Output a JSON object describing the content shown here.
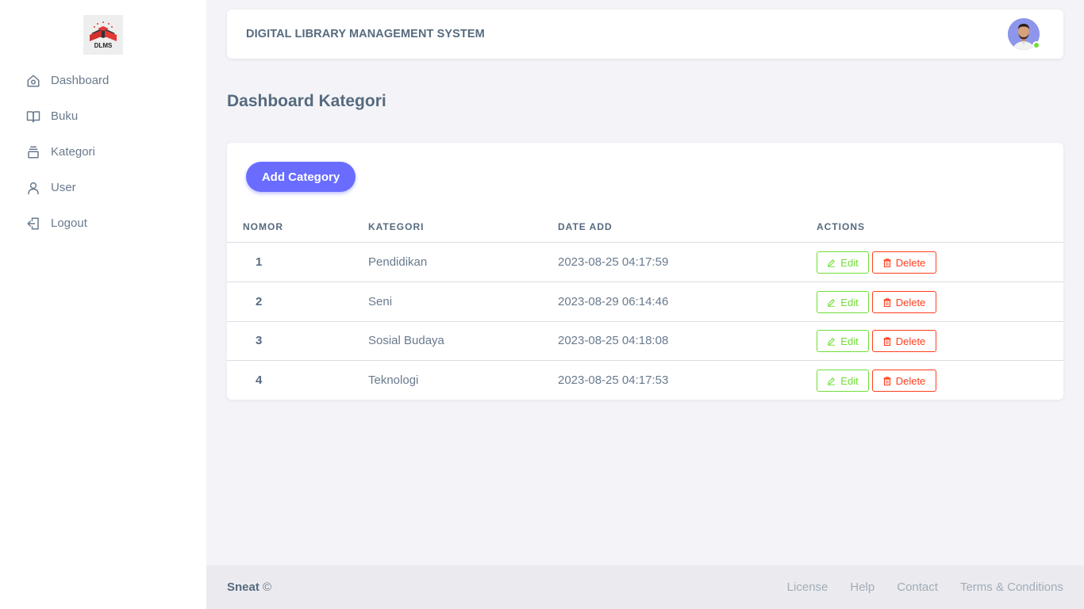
{
  "brand": {
    "logo_text": "DLMS"
  },
  "sidebar": {
    "items": [
      {
        "label": "Dashboard",
        "icon": "home-icon"
      },
      {
        "label": "Buku",
        "icon": "book-icon"
      },
      {
        "label": "Kategori",
        "icon": "collection-icon"
      },
      {
        "label": "User",
        "icon": "user-icon"
      },
      {
        "label": "Logout",
        "icon": "logout-icon"
      }
    ]
  },
  "navbar": {
    "title": "DIGITAL LIBRARY MANAGEMENT SYSTEM",
    "avatar": "user-avatar",
    "status_color": "#71dd37"
  },
  "page": {
    "title": "Dashboard Kategori"
  },
  "card": {
    "add_button": "Add Category",
    "table": {
      "headers": [
        "NOMOR",
        "KATEGORI",
        "DATE ADD",
        "ACTIONS"
      ],
      "rows": [
        {
          "no": "1",
          "kategori": "Pendidikan",
          "date": "2023-08-25 04:17:59"
        },
        {
          "no": "2",
          "kategori": "Seni",
          "date": "2023-08-29 06:14:46"
        },
        {
          "no": "3",
          "kategori": "Sosial Budaya",
          "date": "2023-08-25 04:18:08"
        },
        {
          "no": "4",
          "kategori": "Teknologi",
          "date": "2023-08-25 04:17:53"
        }
      ],
      "edit_label": "Edit",
      "delete_label": "Delete"
    }
  },
  "footer": {
    "brand": "Sneat",
    "copyright": "©",
    "links": [
      "License",
      "Help",
      "Contact",
      "Terms & Conditions"
    ]
  },
  "colors": {
    "primary": "#696cff",
    "success": "#71dd37",
    "danger": "#ff3e1d",
    "text": "#566a7f"
  }
}
